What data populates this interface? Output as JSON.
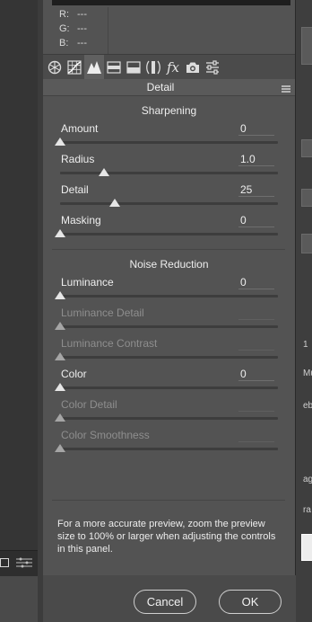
{
  "readout": {
    "r_label": "R:",
    "r_value": "---",
    "g_label": "G:",
    "g_value": "---",
    "b_label": "B:",
    "b_value": "---"
  },
  "tools": [
    {
      "name": "basic-icon"
    },
    {
      "name": "tone-curve-icon"
    },
    {
      "name": "detail-icon",
      "active": true
    },
    {
      "name": "hsl-icon"
    },
    {
      "name": "split-toning-icon"
    },
    {
      "name": "lens-corrections-icon"
    },
    {
      "name": "effects-icon",
      "label": "fx"
    },
    {
      "name": "camera-calibration-icon"
    },
    {
      "name": "presets-icon"
    }
  ],
  "panel": {
    "title": "Detail"
  },
  "sharpening": {
    "title": "Sharpening",
    "amount": {
      "label": "Amount",
      "value": "0"
    },
    "radius": {
      "label": "Radius",
      "value": "1.0"
    },
    "detail": {
      "label": "Detail",
      "value": "25"
    },
    "masking": {
      "label": "Masking",
      "value": "0"
    }
  },
  "noise_reduction": {
    "title": "Noise Reduction",
    "luminance": {
      "label": "Luminance",
      "value": "0"
    },
    "luminance_detail": {
      "label": "Luminance Detail",
      "value": ""
    },
    "luminance_contrast": {
      "label": "Luminance Contrast",
      "value": ""
    },
    "color": {
      "label": "Color",
      "value": "0"
    },
    "color_detail": {
      "label": "Color Detail",
      "value": ""
    },
    "color_smoothness": {
      "label": "Color Smoothness",
      "value": ""
    }
  },
  "slider_levels": {
    "amount": 0,
    "radius": 0.2,
    "detail": 0.25,
    "masking": 0,
    "luminance": 0,
    "luminance_detail": 0,
    "luminance_contrast": 0,
    "color": 0,
    "color_detail": 0,
    "color_smoothness": 0
  },
  "tip": "For a more accurate preview, zoom the preview size to 100% or larger when adjusting the controls in this panel.",
  "buttons": {
    "cancel": "Cancel",
    "ok": "OK"
  },
  "right_edge": [
    "1",
    "Mu",
    "eb",
    "ag",
    "ra"
  ],
  "colors": {
    "panel": "#535353",
    "track": "#3d3d3d",
    "thumb": "#e6e6e6"
  }
}
